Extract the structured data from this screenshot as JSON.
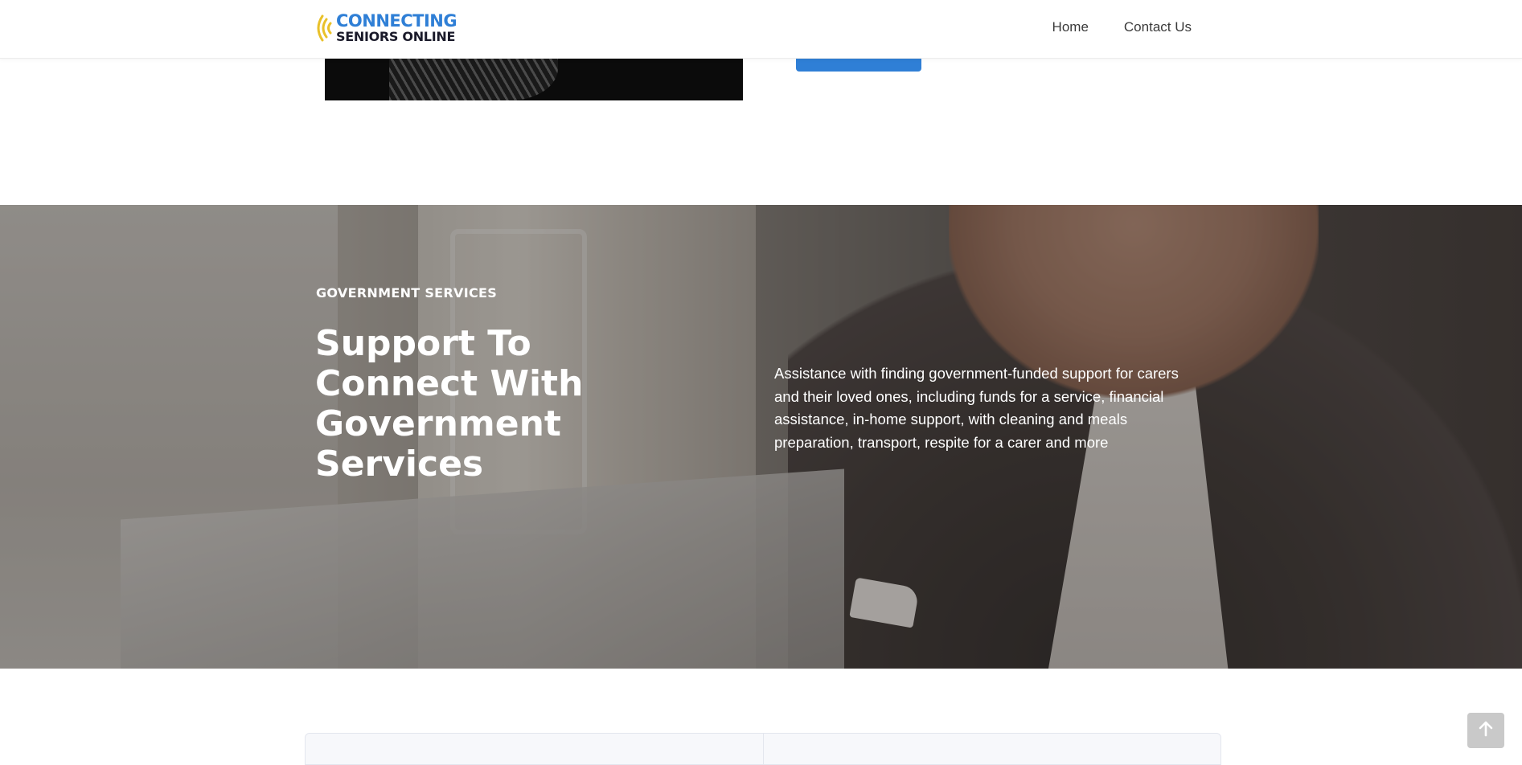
{
  "header": {
    "logo": {
      "line1": "CONNECTING",
      "line2": "SENIORS ONLINE",
      "icon": "signal-waves-icon"
    },
    "nav": [
      {
        "label": "Home"
      },
      {
        "label": "Contact Us"
      }
    ]
  },
  "hero": {
    "eyebrow": "GOVERNMENT SERVICES",
    "title": "Support To Connect With Government Services",
    "description": "Assistance with finding government-funded support for carers and their loved ones, including funds for a service, financial assistance, in-home support, with cleaning and meals preparation, transport, respite for a carer and more"
  },
  "scroll_top": {
    "icon": "arrow-up-icon"
  },
  "colors": {
    "brand_blue": "#2f7fd6",
    "brand_yellow": "#e9c12a",
    "logo_dark": "#1a1a2a"
  }
}
